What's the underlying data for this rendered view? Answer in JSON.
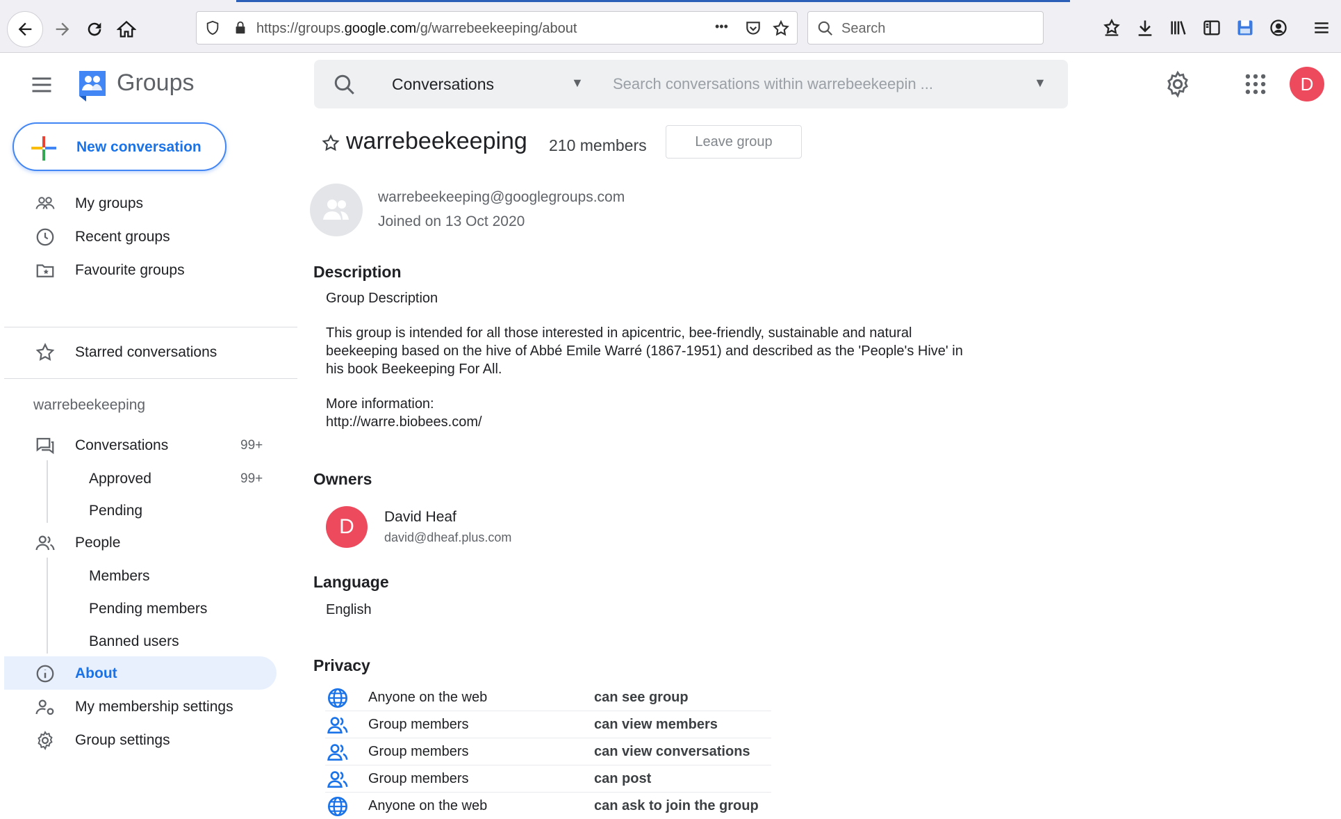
{
  "browser": {
    "url_prefix": "https://groups.",
    "url_domain": "google.com",
    "url_path": "/g/warrebeekeeping/about",
    "url_more": "•••",
    "search_placeholder": "Search"
  },
  "header": {
    "app_name": "Groups",
    "search_scope": "Conversations",
    "search_placeholder": "Search conversations within warrebeekeepin ...",
    "user_initial": "D"
  },
  "sidebar": {
    "new_conversation": "New conversation",
    "my_groups": "My groups",
    "recent_groups": "Recent groups",
    "favourite_groups": "Favourite groups",
    "starred_conversations": "Starred conversations",
    "group_title": "warrebeekeeping",
    "conversations": "Conversations",
    "conversations_count": "99+",
    "approved": "Approved",
    "approved_count": "99+",
    "pending": "Pending",
    "people": "People",
    "members": "Members",
    "pending_members": "Pending members",
    "banned_users": "Banned users",
    "about": "About",
    "my_membership_settings": "My membership settings",
    "group_settings": "Group settings"
  },
  "group": {
    "name": "warrebeekeeping",
    "member_count": "210 members",
    "leave_label": "Leave group",
    "email": "warrebeekeeping@googlegroups.com",
    "joined": "Joined on 13 Oct 2020"
  },
  "description": {
    "heading": "Description",
    "subtitle": "Group Description",
    "paragraph": "This group is intended for all those interested in apicentric, bee-friendly, sustainable and natural beekeeping based on the hive of Abbé Emile Warré (1867-1951) and described as the 'People's Hive' in his book Beekeeping For All.",
    "more_info_label": "More information:",
    "more_info_link": "http://warre.biobees.com/"
  },
  "owners": {
    "heading": "Owners",
    "initial": "D",
    "name": "David Heaf",
    "email": "david@dheaf.plus.com"
  },
  "language": {
    "heading": "Language",
    "value": "English"
  },
  "privacy": {
    "heading": "Privacy",
    "rows": [
      {
        "who": "Anyone on the web",
        "what": "can see group",
        "icon": "globe-icon"
      },
      {
        "who": "Group members",
        "what": "can view members",
        "icon": "people-icon"
      },
      {
        "who": "Group members",
        "what": "can view conversations",
        "icon": "people-icon"
      },
      {
        "who": "Group members",
        "what": "can post",
        "icon": "people-icon"
      },
      {
        "who": "Anyone on the web",
        "what": "can ask to join the group",
        "icon": "globe-icon"
      }
    ]
  },
  "colors": {
    "accent": "#1a73e8",
    "avatar": "#ee4a5d",
    "active_bg": "#e8f0fe"
  }
}
